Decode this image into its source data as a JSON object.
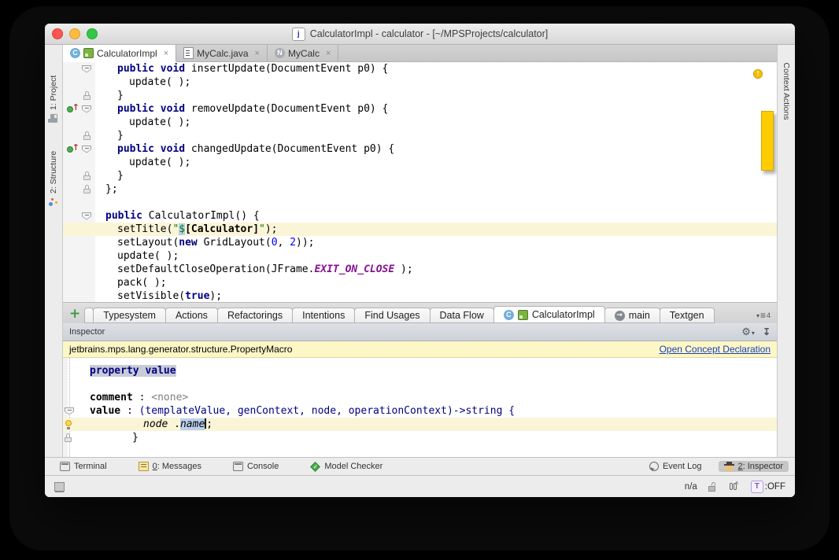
{
  "window": {
    "title": "CalculatorImpl - calculator - [~/MPSProjects/calculator]",
    "title_icon": "j"
  },
  "left_stripe": {
    "items": [
      {
        "label": "1: Project",
        "icon": "project"
      },
      {
        "label": "2: Structure",
        "icon": "structure"
      }
    ]
  },
  "right_stripe": {
    "items": [
      {
        "label": "Context Actions"
      }
    ]
  },
  "editor_tabs": [
    {
      "label": "CalculatorImpl",
      "icons": [
        "class-c",
        "concept"
      ],
      "close": "×",
      "active": true
    },
    {
      "label": "MyCalc.java",
      "icons": [
        "java-file"
      ],
      "close": "×",
      "active": false
    },
    {
      "label": "MyCalc",
      "icons": [
        "node-n"
      ],
      "close": "×",
      "active": false
    }
  ],
  "editor": {
    "analysis_indicator": "warning",
    "lines": [
      {
        "g": [
          "fold"
        ],
        "i": 1,
        "tk": [
          {
            "t": "public void ",
            "c": "kw"
          },
          {
            "t": "insertUpdate(DocumentEvent p0) {",
            "c": "pl"
          }
        ]
      },
      {
        "i": 2,
        "tk": [
          {
            "t": "update( );",
            "c": "pl"
          }
        ]
      },
      {
        "g": [
          "lock"
        ],
        "i": 1,
        "tk": [
          {
            "t": "}",
            "c": "pl"
          }
        ]
      },
      {
        "g": [
          "impl",
          "fold"
        ],
        "i": 1,
        "tk": [
          {
            "t": "public void ",
            "c": "kw"
          },
          {
            "t": "removeUpdate(DocumentEvent p0) {",
            "c": "pl"
          }
        ]
      },
      {
        "i": 2,
        "tk": [
          {
            "t": "update( );",
            "c": "pl"
          }
        ]
      },
      {
        "g": [
          "lock"
        ],
        "i": 1,
        "tk": [
          {
            "t": "}",
            "c": "pl"
          }
        ]
      },
      {
        "g": [
          "impl",
          "fold"
        ],
        "i": 1,
        "tk": [
          {
            "t": "public void ",
            "c": "kw"
          },
          {
            "t": "changedUpdate(DocumentEvent p0) {",
            "c": "pl"
          }
        ]
      },
      {
        "i": 2,
        "tk": [
          {
            "t": "update( );",
            "c": "pl"
          }
        ]
      },
      {
        "g": [
          "lock"
        ],
        "i": 1,
        "tk": [
          {
            "t": "}",
            "c": "pl"
          }
        ]
      },
      {
        "g": [
          "lock"
        ],
        "i": 0,
        "tk": [
          {
            "t": "};",
            "c": "pl"
          }
        ]
      },
      {
        "i": 0,
        "tk": []
      },
      {
        "g": [
          "fold"
        ],
        "i": 0,
        "tk": [
          {
            "t": "public ",
            "c": "kw"
          },
          {
            "t": "CalculatorImpl() {",
            "c": "pl"
          }
        ]
      },
      {
        "hl": true,
        "i": 1,
        "tk": [
          {
            "t": "setTitle(",
            "c": "pl"
          },
          {
            "t": "\"",
            "c": "str"
          },
          {
            "t": "$",
            "c": "str sel"
          },
          {
            "t": "[Calculator]",
            "c": "bd"
          },
          {
            "t": "\"",
            "c": "str"
          },
          {
            "t": ");",
            "c": "pl"
          }
        ]
      },
      {
        "i": 1,
        "tk": [
          {
            "t": "setLayout(",
            "c": "pl"
          },
          {
            "t": "new",
            "c": "kw"
          },
          {
            "t": " GridLayout(",
            "c": "pl"
          },
          {
            "t": "0",
            "c": "num"
          },
          {
            "t": ", ",
            "c": "pl"
          },
          {
            "t": "2",
            "c": "num"
          },
          {
            "t": "));",
            "c": "pl"
          }
        ]
      },
      {
        "i": 1,
        "tk": [
          {
            "t": "update( );",
            "c": "pl"
          }
        ]
      },
      {
        "i": 1,
        "tk": [
          {
            "t": "setDefaultCloseOperation(JFrame.",
            "c": "pl"
          },
          {
            "t": "EXIT_ON_CLOSE",
            "c": "cn"
          },
          {
            "t": " );",
            "c": "pl"
          }
        ]
      },
      {
        "i": 1,
        "tk": [
          {
            "t": "pack( );",
            "c": "pl"
          }
        ]
      },
      {
        "i": 1,
        "tk": [
          {
            "t": "setVisible(",
            "c": "pl"
          },
          {
            "t": "true",
            "c": "kw"
          },
          {
            "t": ");",
            "c": "pl"
          }
        ]
      }
    ]
  },
  "bottom_tabs": {
    "add_button": "+",
    "tabs": [
      {
        "label": "Typesystem"
      },
      {
        "label": "Actions"
      },
      {
        "label": "Refactorings"
      },
      {
        "label": "Intentions"
      },
      {
        "label": "Find Usages"
      },
      {
        "label": "Data Flow"
      },
      {
        "label": "CalculatorImpl",
        "active": true,
        "icons": [
          "class-c",
          "concept"
        ]
      },
      {
        "label": "main",
        "icons": [
          "run-main"
        ]
      },
      {
        "label": "Textgen"
      }
    ],
    "overflow_count": "4"
  },
  "inspector": {
    "header": {
      "title": "Inspector"
    },
    "concept_bar": {
      "name": "jetbrains.mps.lang.generator.structure.PropertyMacro",
      "link": "Open Concept Declaration"
    },
    "lines": [
      {
        "pad": 12,
        "tk": [
          {
            "t": "property value",
            "c": "kw hlsel"
          }
        ]
      },
      {
        "pad": 12,
        "tk": []
      },
      {
        "pad": 12,
        "tk": [
          {
            "t": "comment",
            "c": "bd"
          },
          {
            "t": " : ",
            "c": "pl"
          },
          {
            "t": "<none>",
            "c": "gy"
          }
        ]
      },
      {
        "g": [
          "fold"
        ],
        "pad": 12,
        "tk": [
          {
            "t": "value",
            "c": "bd"
          },
          {
            "t": " : ",
            "c": "pl"
          },
          {
            "t": "(templateValue, genContext, node, operationContext)->string {",
            "c": "nv"
          }
        ]
      },
      {
        "hl": true,
        "g": [
          "bulb"
        ],
        "pad": 80,
        "tk": [
          {
            "t": "node",
            "c": "it"
          },
          {
            "t": " .",
            "c": "pl"
          },
          {
            "t": "name",
            "c": "it sel"
          },
          {
            "c": "cursor"
          },
          {
            "t": ";",
            "c": "pl"
          }
        ]
      },
      {
        "g": [
          "lock"
        ],
        "pad": 66,
        "tk": [
          {
            "t": "}",
            "c": "pl"
          }
        ]
      }
    ]
  },
  "toolbar": {
    "left": [
      {
        "label": "Terminal",
        "icon": "terminal"
      },
      {
        "label": "0: Messages",
        "mnemonic": "0",
        "icon": "messages"
      },
      {
        "label": "Console",
        "icon": "console"
      },
      {
        "label": "Model Checker",
        "icon": "model-checker"
      }
    ],
    "right": [
      {
        "label": "Event Log",
        "icon": "event-log"
      },
      {
        "label": "2: Inspector",
        "mnemonic": "2",
        "icon": "hector",
        "selected": true
      }
    ]
  },
  "statusbar": {
    "memory": "n/a",
    "typesystem_label": "T",
    "typesystem_state": ":OFF"
  }
}
